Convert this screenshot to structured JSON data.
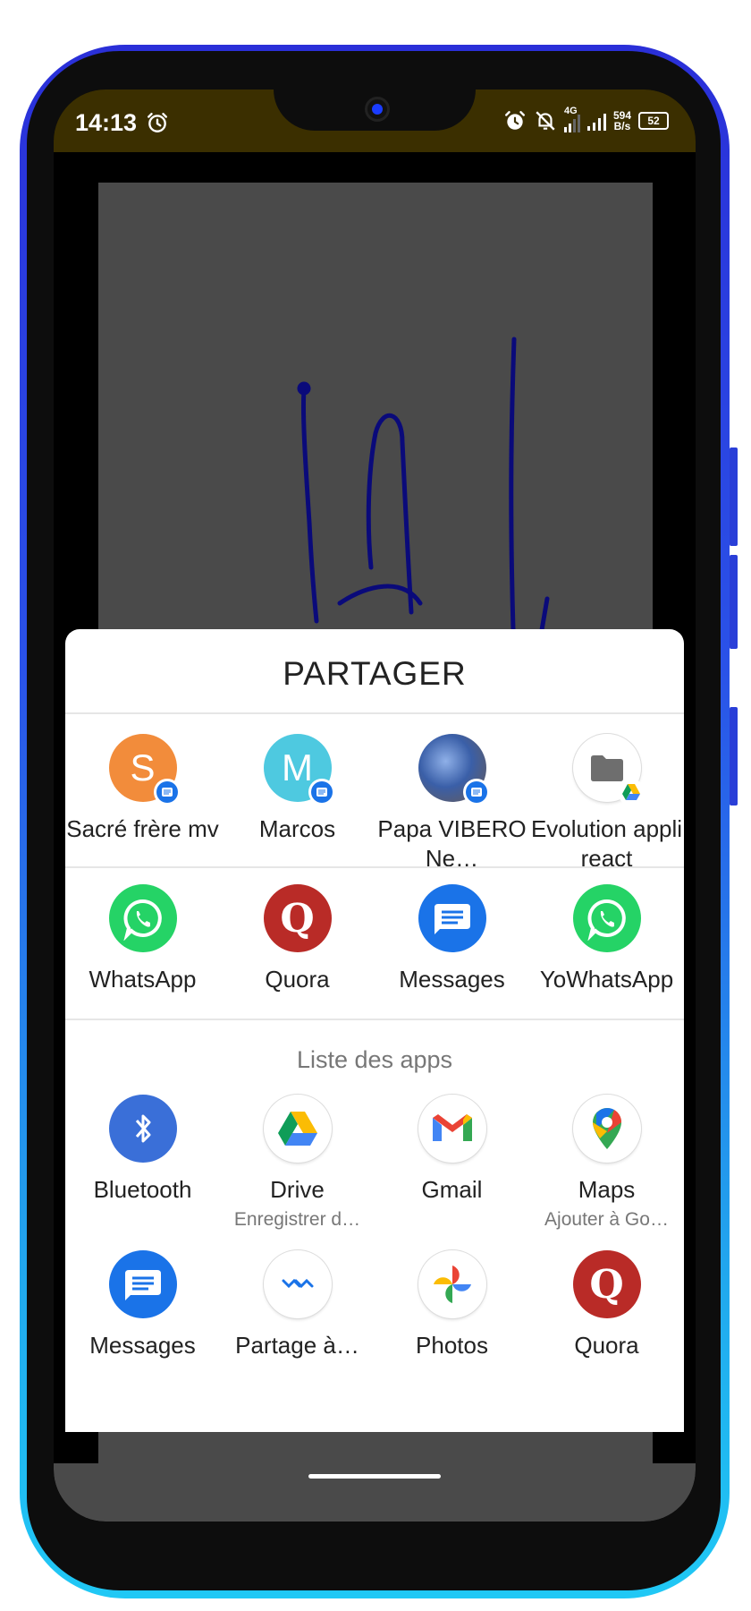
{
  "status_bar": {
    "time": "14:13",
    "network_type": "4G",
    "net_speed_value": "594",
    "net_speed_unit": "B/s",
    "battery_level": "52"
  },
  "share_sheet": {
    "title": "PARTAGER",
    "direct_shares": [
      {
        "label": "Sacré frère mv",
        "avatar_letter": "S",
        "avatar_color": "#f28c3b"
      },
      {
        "label": "Marcos",
        "avatar_letter": "M",
        "avatar_color": "#4ec9e0"
      },
      {
        "label": "Papa VIBERO Ne…",
        "avatar_letter": "",
        "avatar_color": "#5a6f9a"
      },
      {
        "label": "Evolution appli react",
        "avatar_letter": "",
        "avatar_color": "#ffffff"
      }
    ],
    "suggested_apps": [
      {
        "label": "WhatsApp",
        "icon": "whatsapp-icon",
        "color": "#25d366"
      },
      {
        "label": "Quora",
        "icon": "quora-icon",
        "color": "#b92b27"
      },
      {
        "label": "Messages",
        "icon": "messages-icon",
        "color": "#1a73e8"
      },
      {
        "label": "YoWhatsApp",
        "icon": "yowhatsapp-icon",
        "color": "#25d366"
      }
    ],
    "apps_list_label": "Liste des apps",
    "apps": [
      {
        "label": "Bluetooth",
        "sub": "",
        "icon": "bluetooth-icon",
        "color": "#3a6fd8"
      },
      {
        "label": "Drive",
        "sub": "Enregistrer d…",
        "icon": "drive-icon",
        "color": "#ffffff"
      },
      {
        "label": "Gmail",
        "sub": "",
        "icon": "gmail-icon",
        "color": "#ffffff"
      },
      {
        "label": "Maps",
        "sub": "Ajouter à Go…",
        "icon": "maps-icon",
        "color": "#ffffff"
      }
    ],
    "apps_row2": [
      {
        "label": "Messages",
        "icon": "messages-icon",
        "color": "#1a73e8"
      },
      {
        "label": "Partage à…",
        "icon": "nearby-share-icon",
        "color": "#ffffff"
      },
      {
        "label": "Photos",
        "icon": "photos-icon",
        "color": "#ffffff"
      },
      {
        "label": "Quora",
        "icon": "quora-icon",
        "color": "#b92b27"
      }
    ]
  }
}
